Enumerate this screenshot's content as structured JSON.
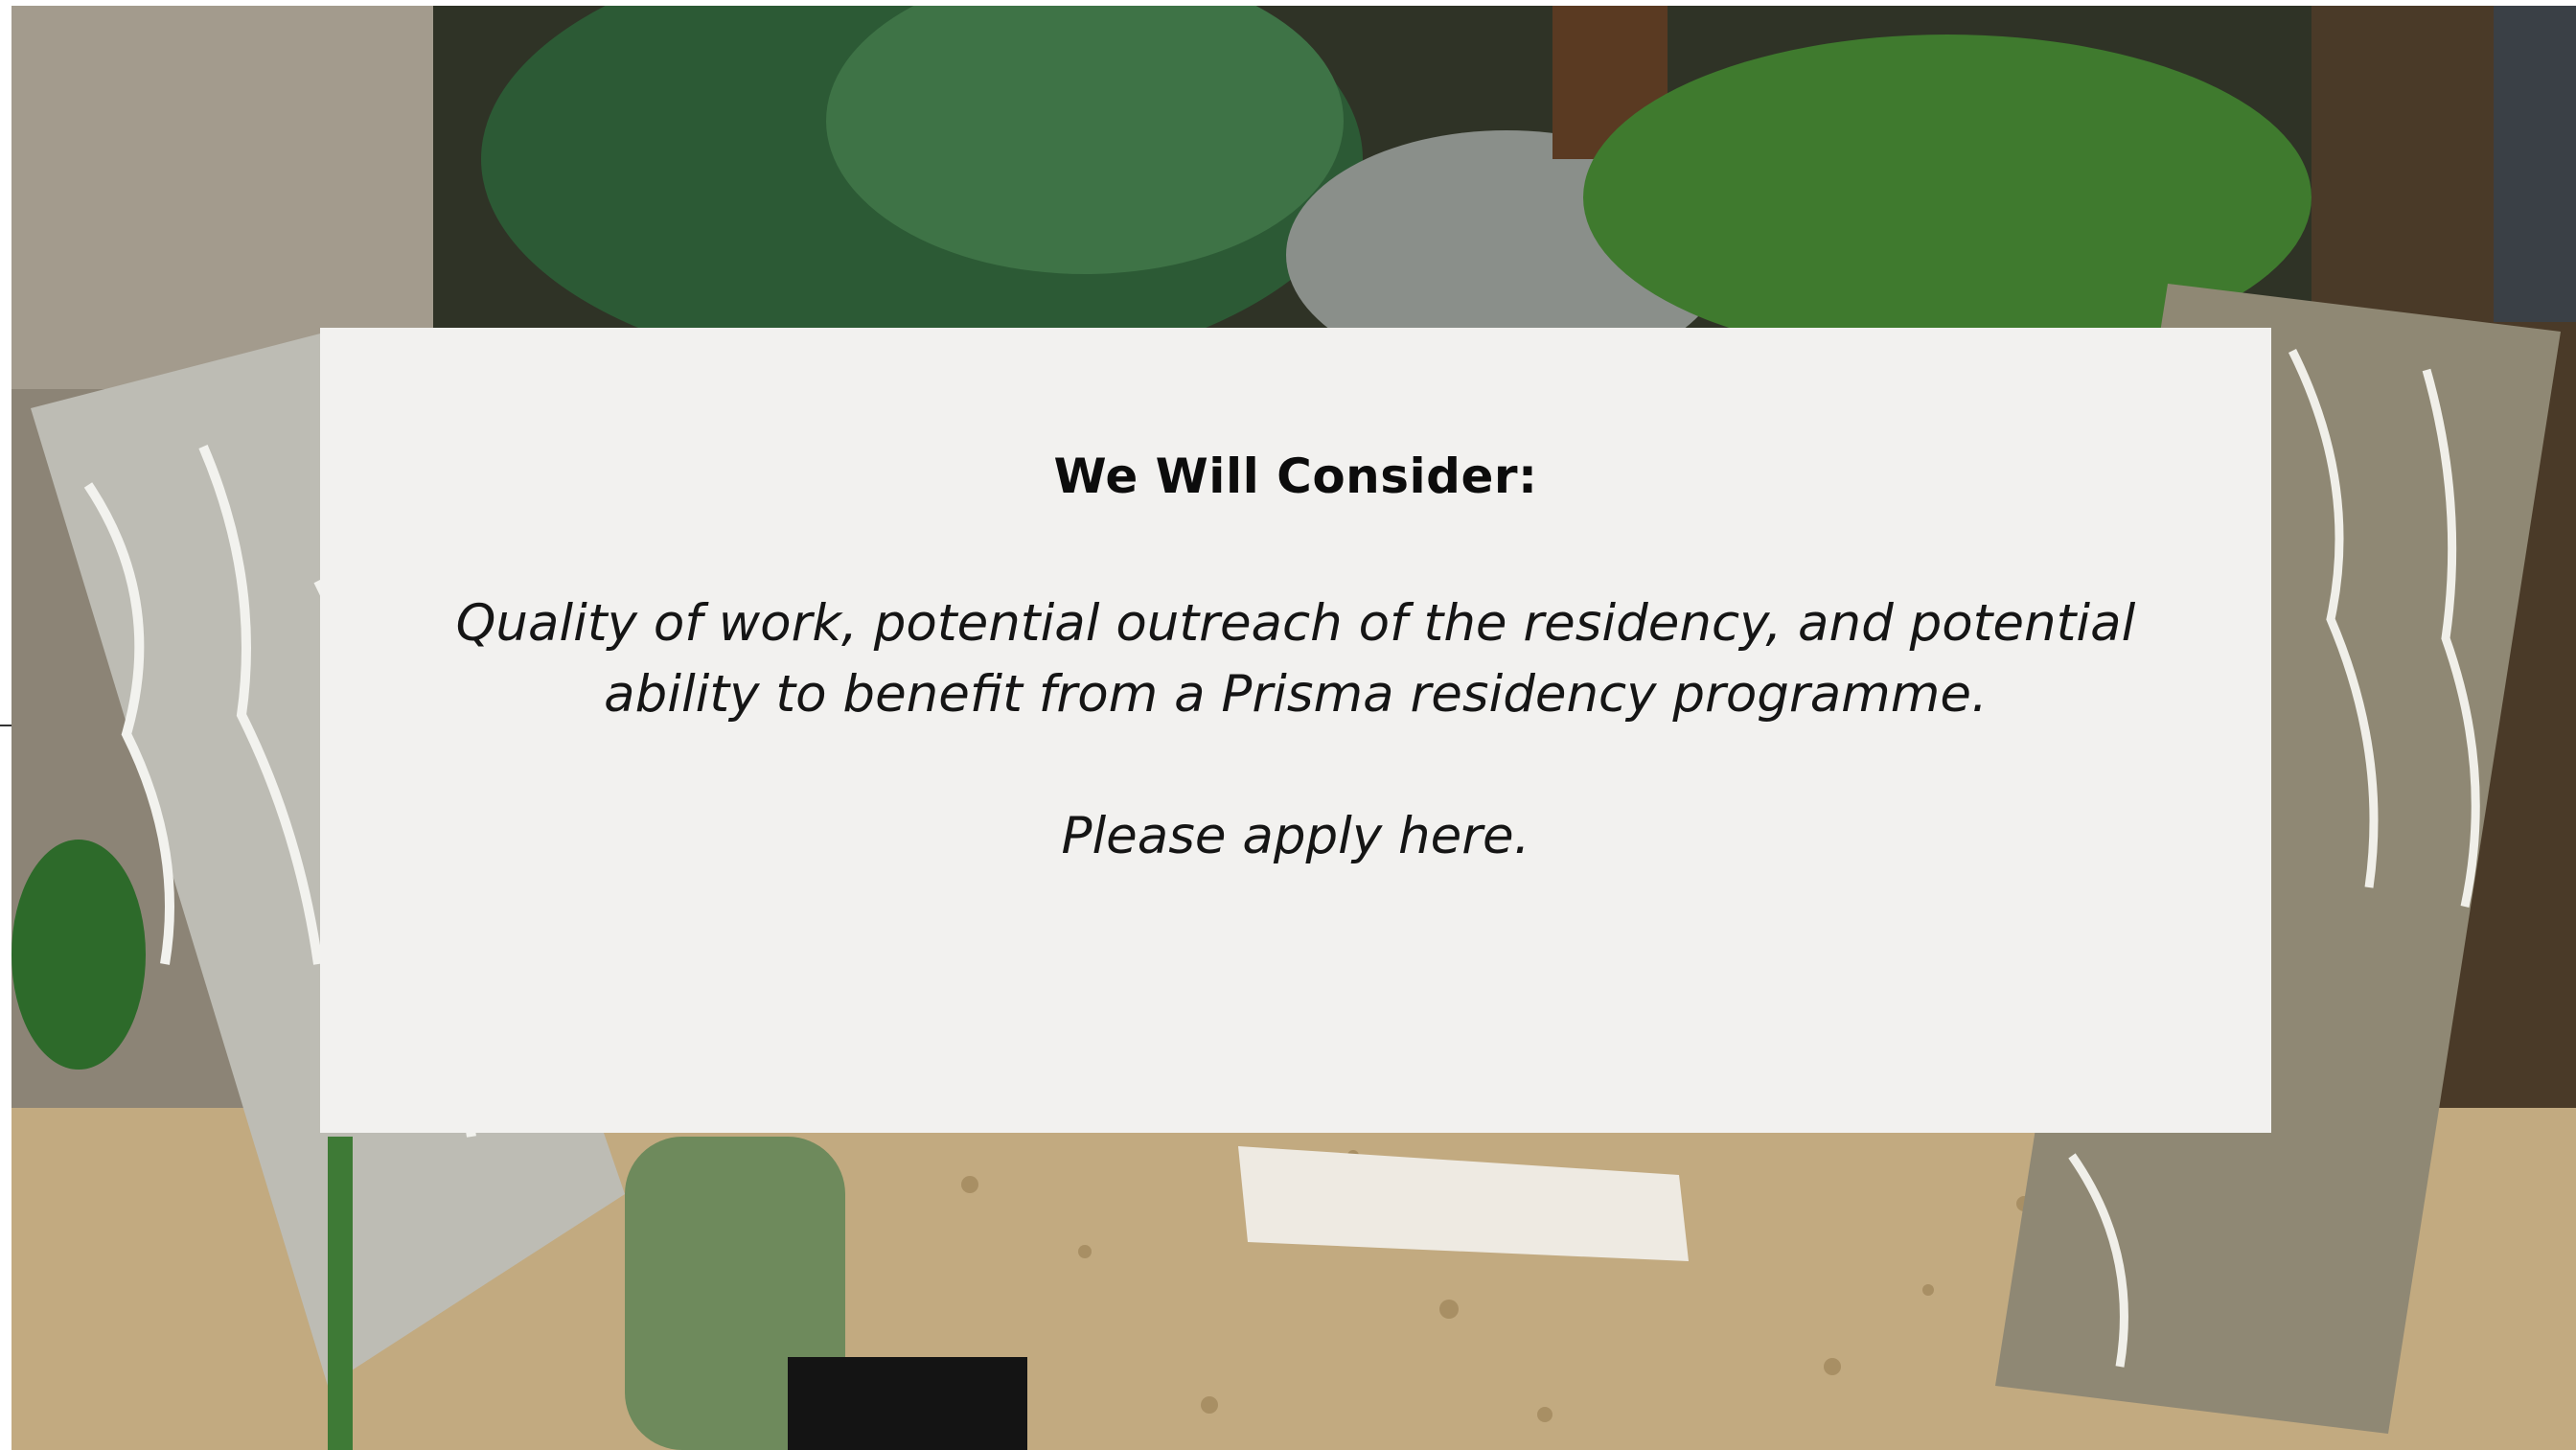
{
  "card": {
    "heading": "We Will Consider:",
    "body": "Quality of work, potential outreach of the residency, and potential ability to benefit from a Prisma residency programme.",
    "cta": "Please apply here."
  },
  "colors": {
    "card_background": "#f2f1ef",
    "text": "#111111"
  }
}
